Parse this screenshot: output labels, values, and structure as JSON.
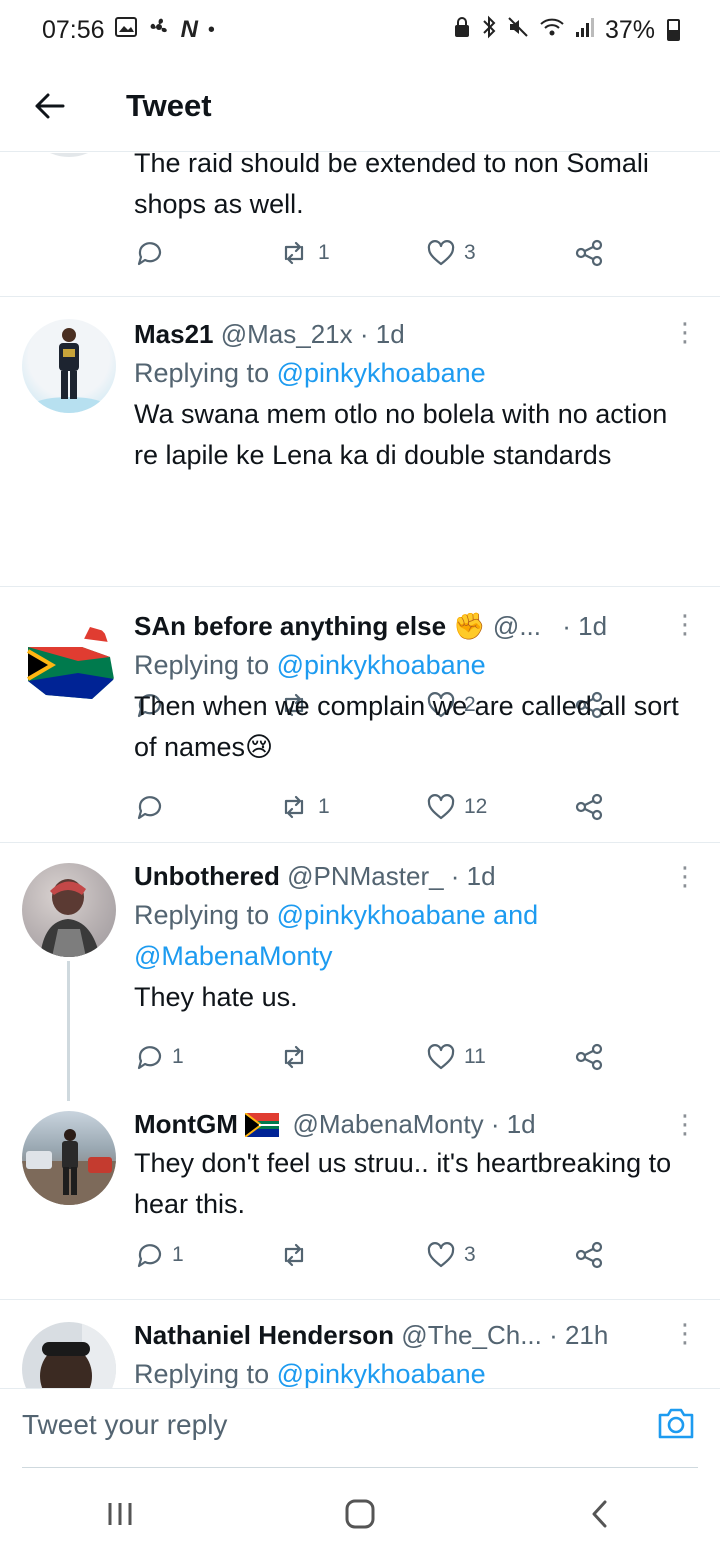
{
  "status_bar": {
    "time": "07:56",
    "left_icons": [
      "image-icon",
      "fan-icon",
      "n-icon",
      "dot-icon"
    ],
    "right_icons": [
      "lock-icon",
      "bluetooth-icon",
      "mute-icon",
      "wifi-icon",
      "signal-icon"
    ],
    "battery": "37%",
    "battery_level": 0.37
  },
  "header": {
    "title": "Tweet"
  },
  "tweets": [
    {
      "body": "The raid should be extended to non Somali shops as well.",
      "replies": "",
      "retweets": "1",
      "likes": "3"
    },
    {
      "name": "Mas21",
      "handle": "@Mas_21x",
      "time": "· 1d",
      "replying_prefix": "Replying to ",
      "mentions": "@pinkykhoabane",
      "body": "Wa swana mem otlo no bolela with no action re lapile ke Lena ka di double standards",
      "replies": "",
      "retweets": "",
      "likes": "2"
    },
    {
      "name": "SAn before anything else",
      "name_emoji": "✊",
      "handle": "@...",
      "time": "· 1d",
      "replying_prefix": "Replying to ",
      "mentions": "@pinkykhoabane",
      "body": "Then when we complain we are called all sort of names😢",
      "replies": "",
      "retweets": "1",
      "likes": "12"
    },
    {
      "name": "Unbothered",
      "handle": "@PNMaster_",
      "time": "· 1d",
      "replying_prefix": "Replying to ",
      "mentions": "@pinkykhoabane and @MabenaMonty",
      "body": "They hate us.",
      "replies": "1",
      "retweets": "",
      "likes": "11"
    },
    {
      "name": "MontGM",
      "handle": "@MabenaMonty",
      "time": "· 1d",
      "body": "They don't feel us struu.. it's heartbreaking to hear this.",
      "replies": "1",
      "retweets": "",
      "likes": "3"
    },
    {
      "name": "Nathaniel Henderson",
      "handle": "@The_Ch...",
      "time": "· 21h",
      "replying_prefix": "Replying to ",
      "mentions": "@pinkykhoabane"
    }
  ],
  "reply_bar": {
    "placeholder": "Tweet your reply"
  },
  "colors": {
    "accent": "#1d9bf0",
    "text": "#0f1419",
    "muted": "#536471",
    "divider": "#e6ecf0"
  }
}
